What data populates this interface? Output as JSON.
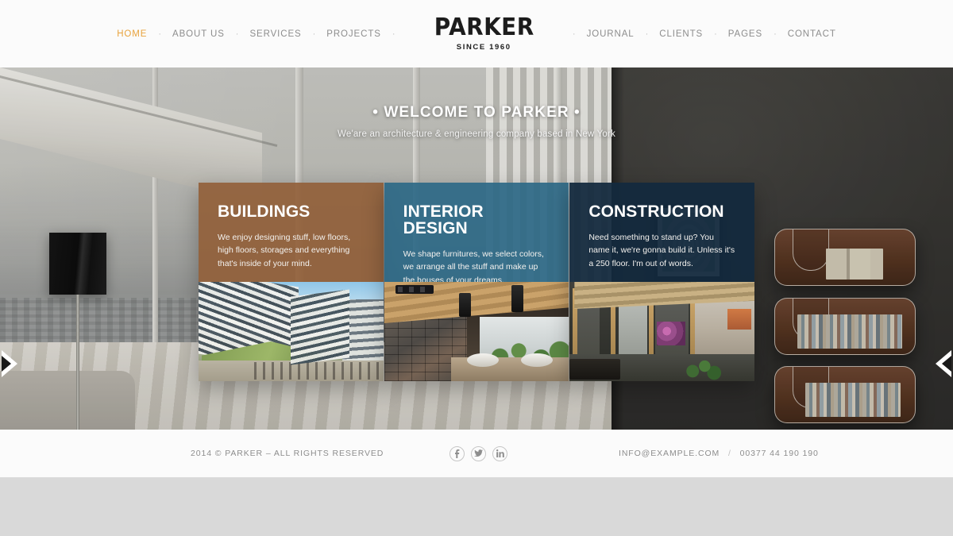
{
  "header": {
    "logo": {
      "name": "PARKER",
      "tagline": "SINCE 1960"
    },
    "nav_left": [
      {
        "label": "HOME",
        "active": true
      },
      {
        "label": "ABOUT US",
        "active": false
      },
      {
        "label": "SERVICES",
        "active": false
      },
      {
        "label": "PROJECTS",
        "active": false
      }
    ],
    "nav_right": [
      {
        "label": "JOURNAL",
        "active": false
      },
      {
        "label": "CLIENTS",
        "active": false
      },
      {
        "label": "PAGES",
        "active": false
      },
      {
        "label": "CONTACT",
        "active": false
      }
    ],
    "separator": "·",
    "accent_color": "#e8a33d",
    "nav_color": "#8d8d8d",
    "background": "#fbfbfb"
  },
  "hero": {
    "title": "• WELCOME TO PARKER •",
    "subtitle": "We'are an architecture & engineering company based in New York",
    "prev_arrow": "prev-slide-arrow",
    "next_arrow": "next-slide-arrow"
  },
  "cards": [
    {
      "title": "BUILDINGS",
      "description": "We enjoy designing stuff, low floors, high floors, storages and everything that's inside of your mind.",
      "color": "#916039",
      "image_alt": "modern-office-buildings-plaza"
    },
    {
      "title": "INTERIOR DESIGN",
      "description": "We shape furnitures, we select colors, we arrange all the stuff and make up the houses of your dreams.",
      "color": "#2d6886",
      "image_alt": "stone-wall-bathroom-with-vessel-sinks"
    },
    {
      "title": "CONSTRUCTION",
      "description": "Need something to stand up? You name it, we're gonna build it. Unless it's a 250 floor. I'm out of words.",
      "color": "#13293e",
      "image_alt": "wood-framed-corridor-interior"
    }
  ],
  "footer": {
    "copyright": "2014 © PARKER  – ALL RIGHTS RESERVED",
    "socials": [
      {
        "name": "facebook-icon",
        "glyph": "f"
      },
      {
        "name": "twitter-icon",
        "glyph": ""
      },
      {
        "name": "linkedin-icon",
        "glyph": "in"
      }
    ],
    "email": "INFO@EXAMPLE.COM",
    "separator": "/",
    "phone": "00377 44 190 190",
    "background": "#fbfbfb"
  },
  "page": {
    "background": "#d9d9d9"
  }
}
